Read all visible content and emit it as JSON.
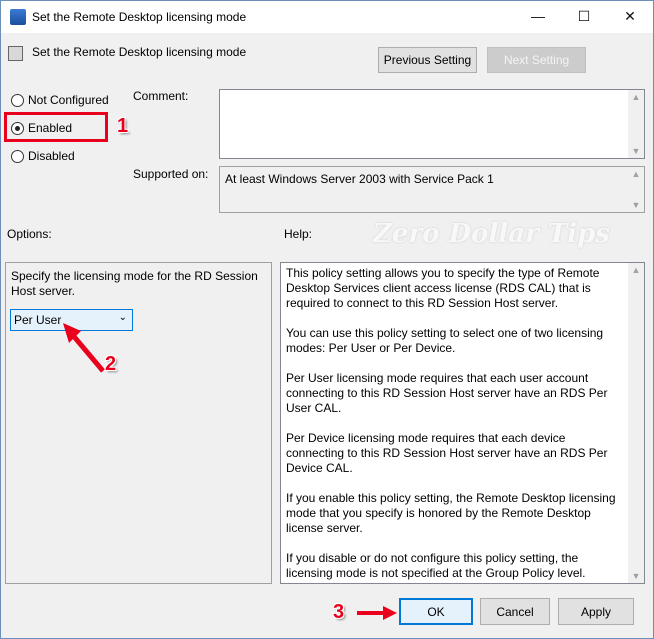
{
  "window": {
    "title": "Set the Remote Desktop licensing mode",
    "minimize": "—",
    "maximize": "☐",
    "close": "✕"
  },
  "header": {
    "setting_name": "Set the Remote Desktop licensing mode",
    "previous_label": "Previous Setting",
    "next_label": "Next Setting"
  },
  "state": {
    "options": [
      {
        "label": "Not Configured",
        "selected": false
      },
      {
        "label": "Enabled",
        "selected": true
      },
      {
        "label": "Disabled",
        "selected": false
      }
    ]
  },
  "comment": {
    "label": "Comment:",
    "value": ""
  },
  "supported": {
    "label": "Supported on:",
    "value": "At least Windows Server 2003 with Service Pack 1"
  },
  "options_panel": {
    "label": "Options:",
    "description": "Specify the licensing mode for the RD Session Host server.",
    "mode_value": "Per User"
  },
  "help_panel": {
    "label": "Help:",
    "paragraphs": [
      "This policy setting allows you to specify the type of Remote Desktop Services client access license (RDS CAL) that is required to connect to this RD Session Host server.",
      "You can use this policy setting to select one of two licensing modes: Per User or Per Device.",
      "Per User licensing mode requires that each user account connecting to this RD Session Host server have an RDS Per User CAL.",
      "Per Device licensing mode requires that each device connecting to this RD Session Host server have an RDS Per Device CAL.",
      "If you enable this policy setting, the Remote Desktop licensing mode that you specify is honored by the Remote Desktop license server.",
      "If you disable or do not configure this policy setting, the licensing mode is not specified at the Group Policy level."
    ]
  },
  "footer": {
    "ok": "OK",
    "cancel": "Cancel",
    "apply": "Apply"
  },
  "annotations": {
    "step1": "1",
    "step2": "2",
    "step3": "3",
    "color": "#e8001c"
  },
  "watermark": "Zero Dollar Tips"
}
